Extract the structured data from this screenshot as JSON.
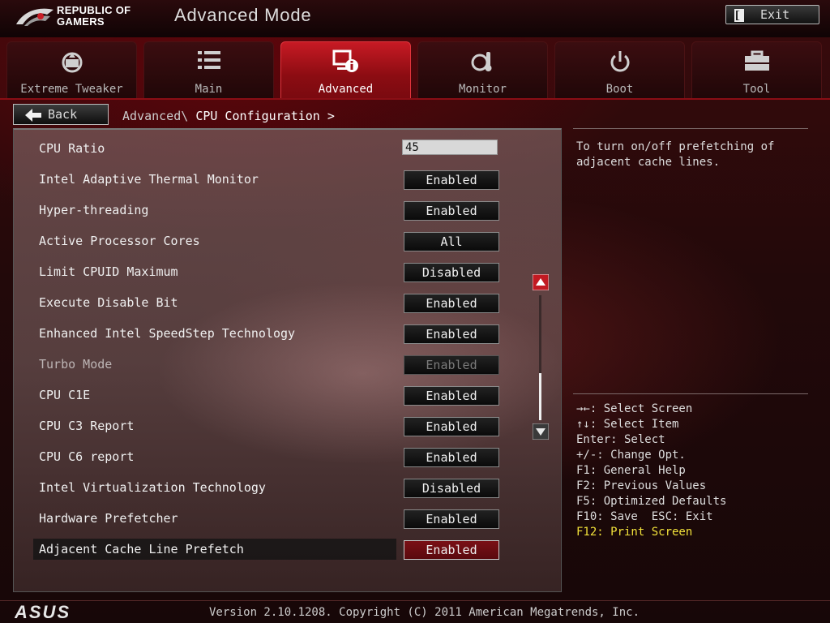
{
  "header": {
    "brand_line1": "REPUBLIC OF",
    "brand_line2": "GAMERS",
    "title": "Advanced Mode",
    "exit_label": "Exit"
  },
  "tabs": [
    {
      "label": "Extreme Tweaker",
      "icon": "tweaker-icon",
      "active": false
    },
    {
      "label": "Main",
      "icon": "list-icon",
      "active": false
    },
    {
      "label": "Advanced",
      "icon": "advanced-info-icon",
      "active": true
    },
    {
      "label": "Monitor",
      "icon": "thermometer-icon",
      "active": false
    },
    {
      "label": "Boot",
      "icon": "power-icon",
      "active": false
    },
    {
      "label": "Tool",
      "icon": "toolbox-icon",
      "active": false
    }
  ],
  "nav": {
    "back_label": "Back",
    "breadcrumb_parent": "Advanced\\",
    "breadcrumb_current": "CPU Configuration >"
  },
  "settings": [
    {
      "label": "CPU Ratio",
      "value": "45",
      "kind": "input"
    },
    {
      "label": "Intel Adaptive Thermal Monitor",
      "value": "Enabled"
    },
    {
      "label": "Hyper-threading",
      "value": "Enabled"
    },
    {
      "label": "Active Processor Cores",
      "value": "All"
    },
    {
      "label": "Limit CPUID Maximum",
      "value": "Disabled"
    },
    {
      "label": "Execute Disable Bit",
      "value": "Enabled"
    },
    {
      "label": "Enhanced Intel SpeedStep Technology",
      "value": "Enabled"
    },
    {
      "label": "Turbo Mode",
      "value": "Enabled",
      "disabled": true
    },
    {
      "label": "CPU C1E",
      "value": "Enabled"
    },
    {
      "label": "CPU C3 Report",
      "value": "Enabled"
    },
    {
      "label": "CPU C6 report",
      "value": "Enabled"
    },
    {
      "label": "Intel Virtualization Technology",
      "value": "Disabled"
    },
    {
      "label": "Hardware Prefetcher",
      "value": "Enabled"
    },
    {
      "label": "Adjacent Cache Line Prefetch",
      "value": "Enabled",
      "selected": true
    }
  ],
  "help": {
    "text": "To turn on/off prefetching of\nadjacent cache lines."
  },
  "keys": [
    "→←: Select Screen",
    "↑↓: Select Item",
    "Enter: Select",
    "+/-: Change Opt.",
    "F1: General Help",
    "F2: Previous Values",
    "F5: Optimized Defaults",
    "F10: Save  ESC: Exit",
    "F12: Print Screen"
  ],
  "footer": {
    "logo": "ASUS",
    "version": "Version 2.10.1208. Copyright (C) 2011 American Megatrends, Inc."
  },
  "colors": {
    "accent_red": "#c71a24",
    "highlight_yellow": "#f2e23a"
  }
}
